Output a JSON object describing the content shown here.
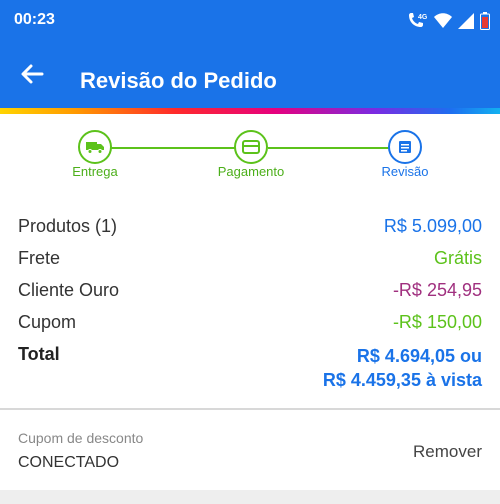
{
  "status_bar": {
    "time": "00:23",
    "network": "4G",
    "icons": [
      "volte-call-icon",
      "wifi-icon",
      "signal-icon",
      "battery-icon"
    ]
  },
  "app_bar": {
    "title": "Revisão do Pedido",
    "back_icon": "arrow-left-icon"
  },
  "stepper": {
    "steps": [
      {
        "label": "Entrega",
        "icon": "truck-icon",
        "state": "done"
      },
      {
        "label": "Pagamento",
        "icon": "card-icon",
        "state": "done"
      },
      {
        "label": "Revisão",
        "icon": "document-icon",
        "state": "current"
      }
    ]
  },
  "summary": {
    "products_label": "Produtos (1)",
    "products_value": "R$ 5.099,00",
    "shipping_label": "Frete",
    "shipping_value": "Grátis",
    "gold_label": "Cliente Ouro",
    "gold_value": "-R$ 254,95",
    "coupon_label": "Cupom",
    "coupon_value": "-R$ 150,00",
    "total_label": "Total",
    "total_value_installments": "R$ 4.694,05 ou",
    "total_value_cash": "R$ 4.459,35 à vista"
  },
  "coupon": {
    "label": "Cupom de desconto",
    "code": "CONECTADO",
    "remove_label": "Remover"
  },
  "colors": {
    "primary": "#1a73e8",
    "success": "#5cc21b",
    "gold_discount": "#a0307f",
    "coupon_discount": "#5cc21b",
    "price": "#1a73e8"
  }
}
